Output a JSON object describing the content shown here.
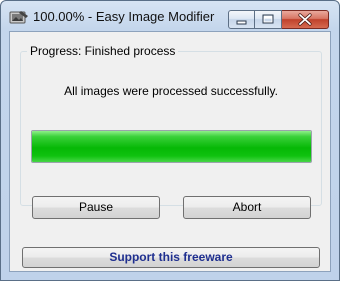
{
  "window": {
    "title": "100.00% - Easy Image Modifier",
    "icons": {
      "app": "image-modifier-app-icon",
      "minimize": "minimize-icon",
      "maximize": "maximize-icon",
      "close": "close-icon"
    }
  },
  "progress": {
    "group_label": "Progress: Finished process",
    "message": "All images were processed successfully.",
    "value_percent": 100,
    "fill_color": "#06b806"
  },
  "buttons": {
    "pause": "Pause",
    "abort": "Abort",
    "support": "Support this freeware"
  },
  "colors": {
    "support_text": "#1f2f8f",
    "close_button": "#c0412b"
  }
}
